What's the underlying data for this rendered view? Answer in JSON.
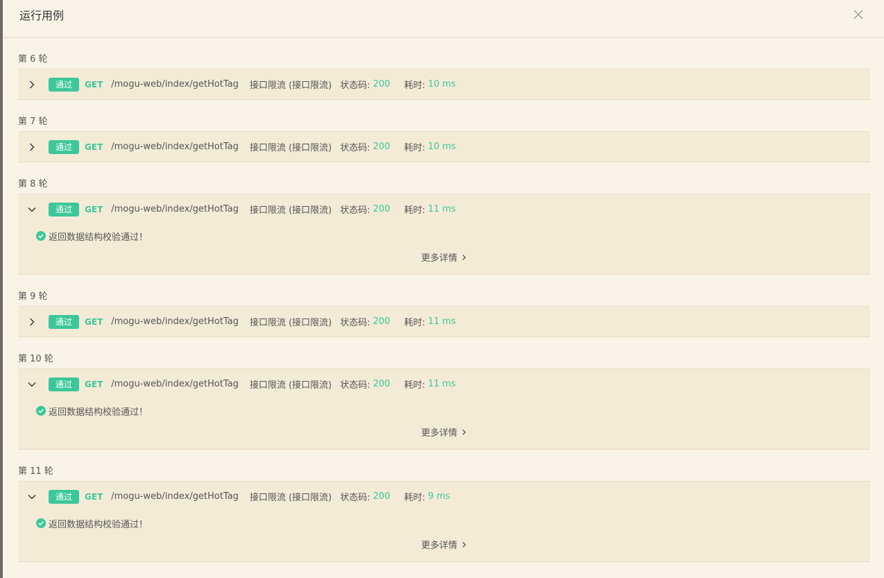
{
  "header": {
    "title": "运行用例"
  },
  "labels": {
    "badge": "通过",
    "method": "GET",
    "url": "/mogu-web/index/getHotTag",
    "api": "接口限流 (接口限流)",
    "status_label": "状态码:",
    "time_label": "耗时:",
    "check_message": "返回数据结构校验通过！",
    "more": "更多详情"
  },
  "rounds": [
    {
      "label": "第 6 轮",
      "status": "200",
      "time": "10 ms",
      "expanded": false
    },
    {
      "label": "第 7 轮",
      "status": "200",
      "time": "10 ms",
      "expanded": false
    },
    {
      "label": "第 8 轮",
      "status": "200",
      "time": "11 ms",
      "expanded": true
    },
    {
      "label": "第 9 轮",
      "status": "200",
      "time": "11 ms",
      "expanded": false
    },
    {
      "label": "第 10 轮",
      "status": "200",
      "time": "11 ms",
      "expanded": true
    },
    {
      "label": "第 11 轮",
      "status": "200",
      "time": "9 ms",
      "expanded": true
    }
  ],
  "colors": {
    "accent": "#3cc79a",
    "background": "#faf3e8",
    "card": "#f4ebd6"
  },
  "icons": {
    "close": "close-icon",
    "collapsed": "chevron-right-icon",
    "expanded": "chevron-down-icon",
    "check": "check-circle-icon"
  }
}
